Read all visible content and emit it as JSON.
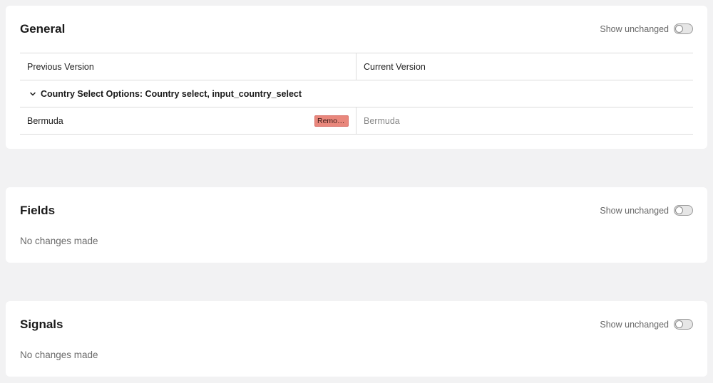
{
  "sections": {
    "general": {
      "title": "General",
      "toggle_label": "Show unchanged",
      "columns": {
        "previous": "Previous Version",
        "current": "Current Version"
      },
      "group_label": "Country Select Options: Country select, input_country_select",
      "rows": [
        {
          "previous": "Bermuda",
          "badge": "Removed",
          "current": "Bermuda"
        }
      ]
    },
    "fields": {
      "title": "Fields",
      "toggle_label": "Show unchanged",
      "empty": "No changes made"
    },
    "signals": {
      "title": "Signals",
      "toggle_label": "Show unchanged",
      "empty": "No changes made"
    }
  },
  "colors": {
    "background": "#f2f2f3",
    "card": "#ffffff",
    "removed_badge": "#e9877c"
  },
  "icons": {
    "group_toggle": "chevron-down-icon"
  }
}
